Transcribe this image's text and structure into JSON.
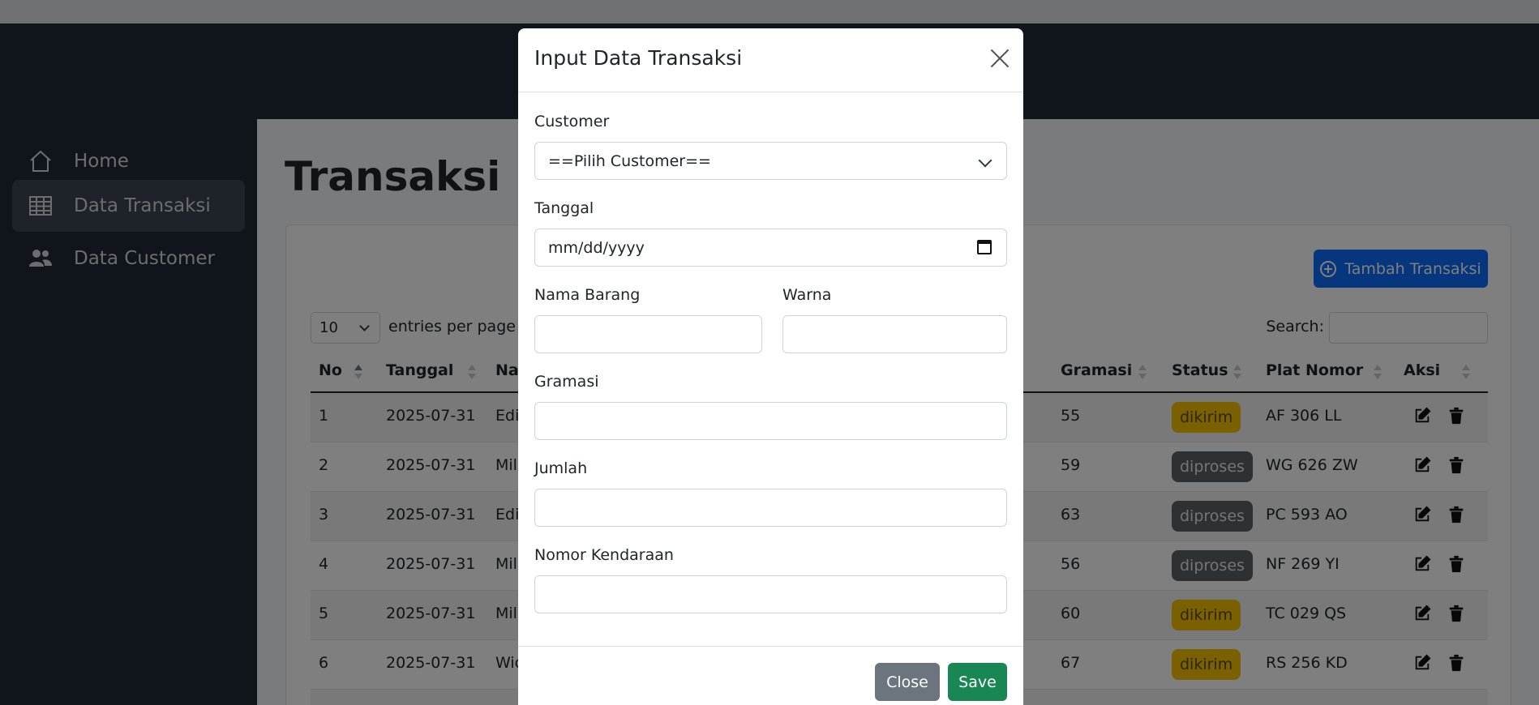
{
  "sidebar": {
    "items": [
      {
        "label": "Home",
        "icon": "home-icon"
      },
      {
        "label": "Data Transaksi",
        "icon": "table-icon",
        "active": true
      },
      {
        "label": "Data Customer",
        "icon": "users-icon"
      }
    ]
  },
  "main": {
    "title": "Transaksi",
    "add_button": "Tambah Transaksi",
    "length_value": "10",
    "length_label": "entries per page",
    "search_label": "Search:",
    "columns": [
      "No",
      "Tanggal",
      "Na",
      "Gramasi",
      "Status",
      "Plat Nomor",
      "Aksi"
    ],
    "rows": [
      {
        "no": "1",
        "tanggal": "2025-07-31",
        "nama": "Edi",
        "gramasi": "55",
        "status": "dikirim",
        "plat": "AF 306 LL"
      },
      {
        "no": "2",
        "tanggal": "2025-07-31",
        "nama": "Mil",
        "gramasi": "59",
        "status": "diproses",
        "plat": "WG 626 ZW"
      },
      {
        "no": "3",
        "tanggal": "2025-07-31",
        "nama": "Edi",
        "gramasi": "63",
        "status": "diproses",
        "plat": "PC 593 AO"
      },
      {
        "no": "4",
        "tanggal": "2025-07-31",
        "nama": "Mil",
        "gramasi": "56",
        "status": "diproses",
        "plat": "NF 269 YI"
      },
      {
        "no": "5",
        "tanggal": "2025-07-31",
        "nama": "Mil",
        "gramasi": "60",
        "status": "dikirim",
        "plat": "TC 029 QS"
      },
      {
        "no": "6",
        "tanggal": "2025-07-31",
        "nama": "Wic",
        "gramasi": "67",
        "status": "dikirim",
        "plat": "RS 256 KD"
      }
    ]
  },
  "modal": {
    "title": "Input Data Transaksi",
    "customer_label": "Customer",
    "customer_value": "==Pilih Customer==",
    "tanggal_label": "Tanggal",
    "tanggal_placeholder": "mm/dd/yyyy",
    "nama_barang_label": "Nama Barang",
    "warna_label": "Warna",
    "gramasi_label": "Gramasi",
    "jumlah_label": "Jumlah",
    "nomor_kendaraan_label": "Nomor Kendaraan",
    "close_label": "Close",
    "save_label": "Save"
  },
  "colors": {
    "sidebar_bg": "#212b36",
    "primary": "#0d6efd",
    "success": "#198754",
    "secondary": "#6c757d",
    "warning": "#f6c000"
  }
}
